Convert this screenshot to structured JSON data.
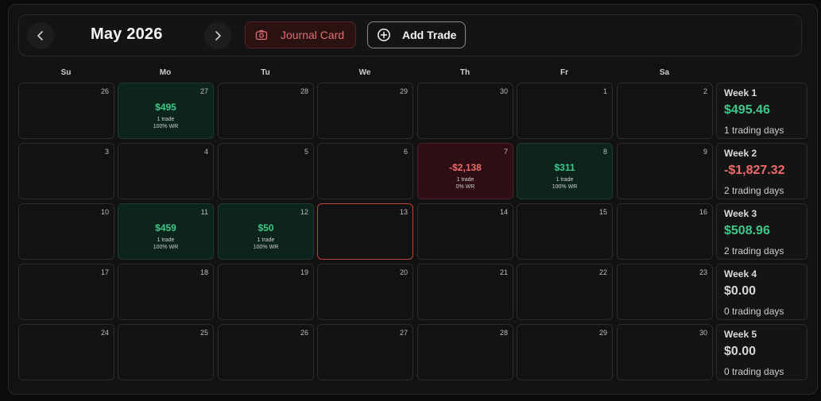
{
  "header": {
    "month_title": "May 2026",
    "prev_icon": "chevron-left-icon",
    "next_icon": "chevron-right-icon",
    "journal_label": "Journal Card",
    "journal_icon": "camera-icon",
    "add_label": "Add Trade",
    "add_icon": "plus-circle-icon"
  },
  "weekdays": [
    "Su",
    "Mo",
    "Tu",
    "We",
    "Th",
    "Fr",
    "Sa"
  ],
  "colors": {
    "profit": "#3ec98b",
    "loss": "#ef6b6b",
    "today_border": "#b8453e"
  },
  "weeks": [
    {
      "label": "Week 1",
      "pnl": "$495.46",
      "pnl_sign": "pos",
      "days_text": "1 trading days",
      "days": [
        {
          "d": "26"
        },
        {
          "d": "27",
          "pnl": "$495",
          "status": "win",
          "trades": "1 trade",
          "wr": "100% WR"
        },
        {
          "d": "28"
        },
        {
          "d": "29"
        },
        {
          "d": "30"
        },
        {
          "d": "1"
        },
        {
          "d": "2"
        }
      ]
    },
    {
      "label": "Week 2",
      "pnl": "-$1,827.32",
      "pnl_sign": "neg",
      "days_text": "2 trading days",
      "days": [
        {
          "d": "3"
        },
        {
          "d": "4"
        },
        {
          "d": "5"
        },
        {
          "d": "6"
        },
        {
          "d": "7",
          "pnl": "-$2,138",
          "status": "loss",
          "trades": "1 trade",
          "wr": "0% WR"
        },
        {
          "d": "8",
          "pnl": "$311",
          "status": "win",
          "trades": "1 trade",
          "wr": "100% WR"
        },
        {
          "d": "9"
        }
      ]
    },
    {
      "label": "Week 3",
      "pnl": "$508.96",
      "pnl_sign": "pos",
      "days_text": "2 trading days",
      "days": [
        {
          "d": "10"
        },
        {
          "d": "11",
          "pnl": "$459",
          "status": "win",
          "trades": "1 trade",
          "wr": "100% WR"
        },
        {
          "d": "12",
          "pnl": "$50",
          "status": "win",
          "trades": "1 trade",
          "wr": "100% WR"
        },
        {
          "d": "13",
          "today": true
        },
        {
          "d": "14"
        },
        {
          "d": "15"
        },
        {
          "d": "16"
        }
      ]
    },
    {
      "label": "Week 4",
      "pnl": "$0.00",
      "pnl_sign": "zero",
      "days_text": "0 trading days",
      "days": [
        {
          "d": "17"
        },
        {
          "d": "18"
        },
        {
          "d": "19"
        },
        {
          "d": "20"
        },
        {
          "d": "21"
        },
        {
          "d": "22"
        },
        {
          "d": "23"
        }
      ]
    },
    {
      "label": "Week 5",
      "pnl": "$0.00",
      "pnl_sign": "zero",
      "days_text": "0 trading days",
      "days": [
        {
          "d": "24"
        },
        {
          "d": "25"
        },
        {
          "d": "26"
        },
        {
          "d": "27"
        },
        {
          "d": "28"
        },
        {
          "d": "29"
        },
        {
          "d": "30"
        }
      ]
    }
  ]
}
